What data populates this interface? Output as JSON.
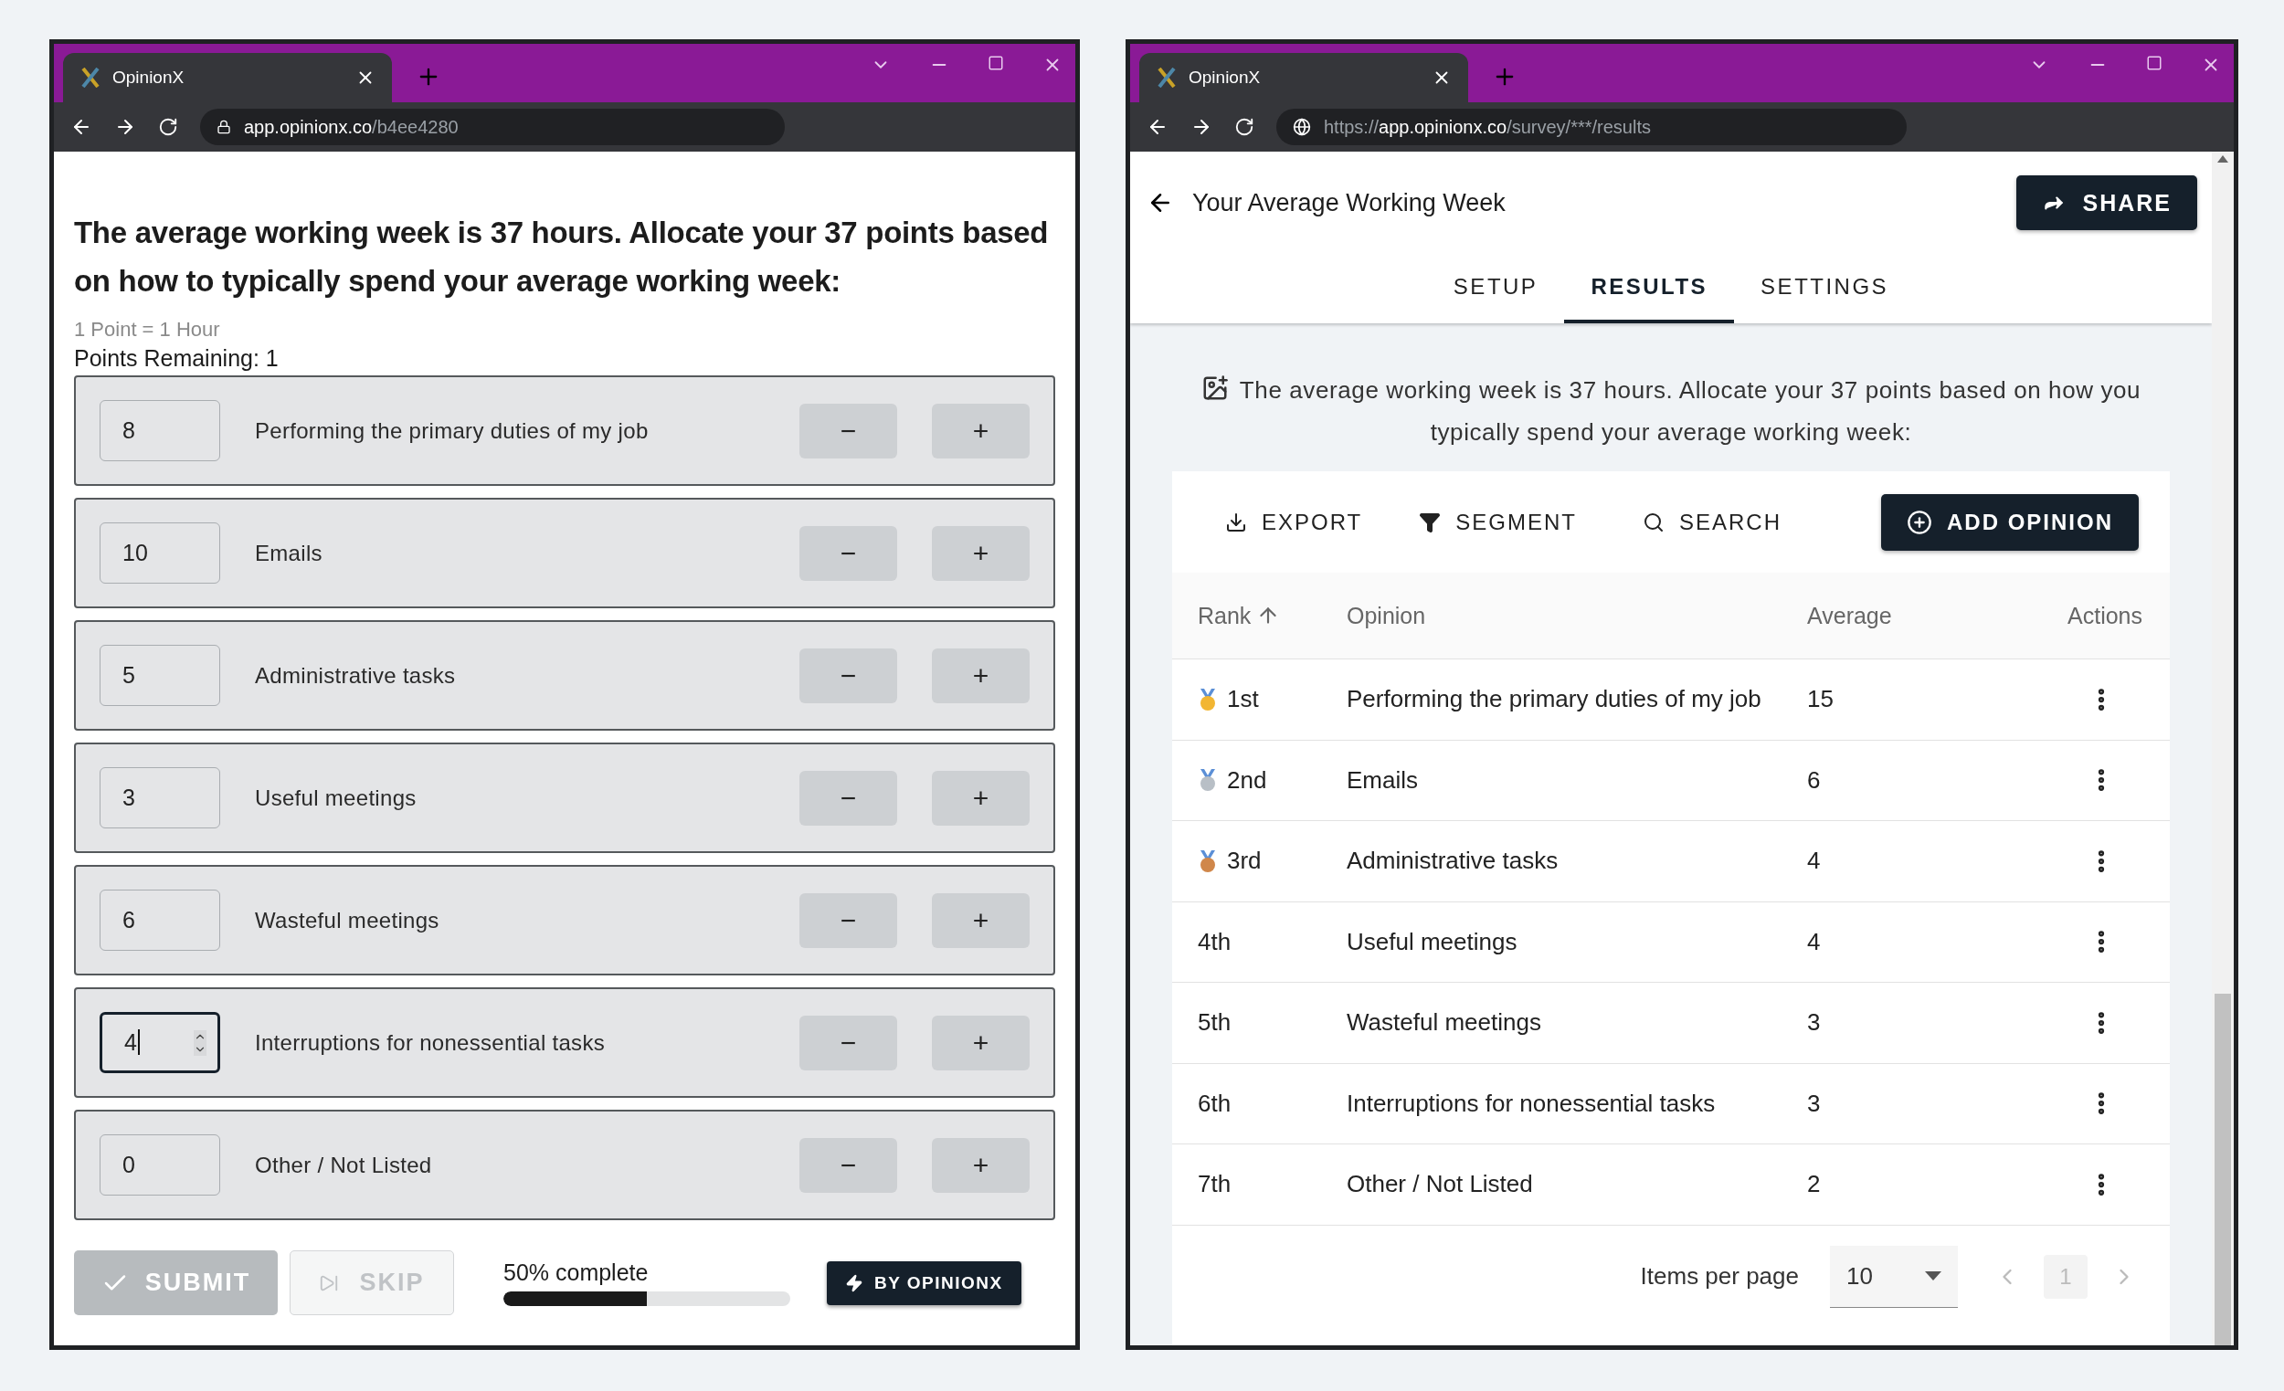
{
  "survey_window": {
    "tab_title": "OpinionX",
    "url_host": "app.opinionx.co",
    "url_path": "/b4ee4280",
    "question": "The average working week is 37 hours. Allocate your 37 points based on how to typically spend your average working week:",
    "note": "1 Point = 1 Hour",
    "points_remaining": "Points Remaining: 1",
    "options": [
      {
        "value": "8",
        "label": "Performing the primary duties of my job",
        "focused": false
      },
      {
        "value": "10",
        "label": "Emails",
        "focused": false
      },
      {
        "value": "5",
        "label": "Administrative tasks",
        "focused": false
      },
      {
        "value": "3",
        "label": "Useful meetings",
        "focused": false
      },
      {
        "value": "6",
        "label": "Wasteful meetings",
        "focused": false
      },
      {
        "value": "4",
        "label": "Interruptions for nonessential tasks",
        "focused": true
      },
      {
        "value": "0",
        "label": "Other / Not Listed",
        "focused": false
      }
    ],
    "minus": "−",
    "plus": "+",
    "submit": {
      "label": "SUBMIT",
      "disabled": true
    },
    "skip": {
      "label": "SKIP",
      "disabled": true
    },
    "progress": {
      "text": "50% complete",
      "level": 0.5
    },
    "badge": "BY OPINIONX"
  },
  "results_window": {
    "tab_title": "OpinionX",
    "url_scheme": "https://",
    "url_host": "app.opinionx.co",
    "url_path": "/survey/***/results",
    "title": "Your Average Working Week",
    "share": "SHARE",
    "tabs": [
      {
        "label": "SETUP",
        "selected": false
      },
      {
        "label": "RESULTS",
        "selected": true
      },
      {
        "label": "SETTINGS",
        "selected": false
      }
    ],
    "question": "The average working week is 37 hours. Allocate your 37 points based on how you typically spend your average working week:",
    "toolbar": [
      {
        "kind": "export",
        "label": "EXPORT"
      },
      {
        "kind": "segment",
        "label": "SEGMENT"
      },
      {
        "kind": "search",
        "label": "SEARCH"
      }
    ],
    "add_opinion": "ADD OPINION",
    "columns": [
      "Rank",
      "Opinion",
      "Average",
      "Actions"
    ],
    "rows": [
      {
        "color": "#f2b632",
        "rank": "1st",
        "opinion": "Performing the primary duties of my job",
        "average": "15"
      },
      {
        "color": "#b8bfc6",
        "rank": "2nd",
        "opinion": "Emails",
        "average": "6"
      },
      {
        "color": "#d0874a",
        "rank": "3rd",
        "opinion": "Administrative tasks",
        "average": "4"
      },
      {
        "rank": "4th",
        "opinion": "Useful meetings",
        "average": "4"
      },
      {
        "rank": "5th",
        "opinion": "Wasteful meetings",
        "average": "3"
      },
      {
        "rank": "6th",
        "opinion": "Interruptions for nonessential tasks",
        "average": "3"
      },
      {
        "rank": "7th",
        "opinion": "Other / Not Listed",
        "average": "2"
      }
    ],
    "items_per_page_label": "Items per page",
    "items_per_page": "10",
    "page": "1"
  }
}
